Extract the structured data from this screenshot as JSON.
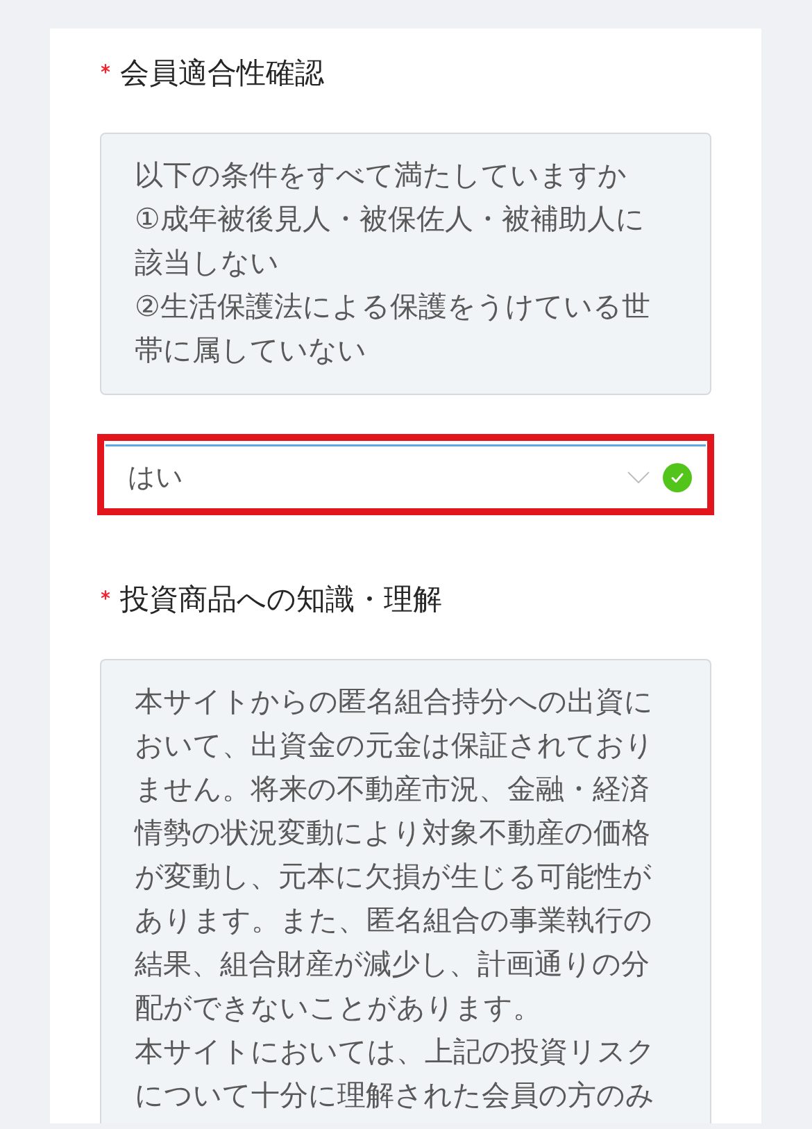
{
  "sections": [
    {
      "required": true,
      "label": "会員適合性確認",
      "notice": [
        "以下の条件をすべて満たしていますか",
        "①成年被後見人・被保佐人・被補助人に該当しない",
        "②生活保護法による保護をうけている世帯に属していない"
      ],
      "answer": {
        "value": "はい",
        "valid": true,
        "highlighted": true
      }
    },
    {
      "required": true,
      "label": "投資商品への知識・理解",
      "notice": [
        "本サイトからの匿名組合持分への出資において、出資金の元金は保証されておりません。将来の不動産市況、金融・経済情勢の状況変動により対象不動産の価格が変動し、元本に欠損が生じる可能性があります。また、匿名組合の事業執行の結果、組合財産が減少し、計画通りの分配ができないことがあります。",
        "本サイトにおいては、上記の投資リスクについて十分に理解された会員の方のみ"
      ]
    }
  ]
}
